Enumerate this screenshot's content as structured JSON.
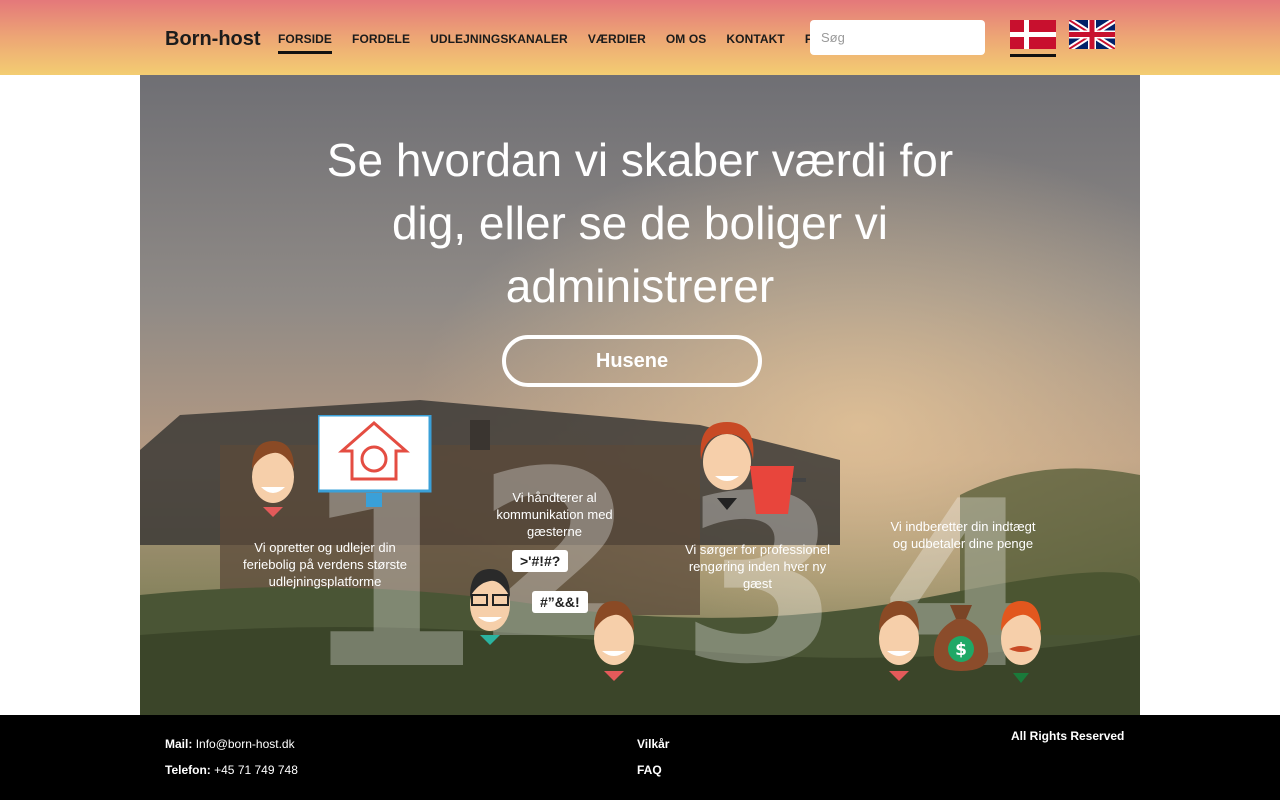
{
  "header": {
    "logo": "Born-host",
    "nav": [
      {
        "label": "FORSIDE"
      },
      {
        "label": "FORDELE"
      },
      {
        "label": "UDLEJNINGSKANALER"
      },
      {
        "label": "VÆRDIER"
      },
      {
        "label": "OM OS"
      },
      {
        "label": "KONTAKT"
      },
      {
        "label": "FAQ"
      }
    ],
    "active_nav": "FORSIDE",
    "search_placeholder": "Søg",
    "languages": [
      "danish-flag-icon",
      "uk-flag-icon"
    ],
    "active_language": "danish-flag-icon"
  },
  "hero": {
    "title": "Se hvordan vi skaber værdi for dig, eller se de boliger vi administrerer",
    "button": "Husene",
    "steps": [
      {
        "number": "1",
        "text": "Vi opretter og udlejer din feriebolig på verdens største udlejningsplatforme"
      },
      {
        "number": "2",
        "text": "Vi håndterer al kommunikation med gæsterne",
        "bubble1": ">'#!#?",
        "bubble2": "#”&&!"
      },
      {
        "number": "3",
        "text": "Vi sørger for professionel rengøring inden hver ny gæst"
      },
      {
        "number": "4",
        "text": "Vi indberetter din indtægt og udbetaler dine penge"
      }
    ]
  },
  "footer": {
    "mail_label": "Mail:",
    "mail_value": "Info@born-host.dk",
    "phone_label": "Telefon:",
    "phone_value": "+45 71 749 748",
    "links": [
      "Vilkår",
      "FAQ"
    ],
    "rights": "All Rights Reserved"
  },
  "colors": {
    "header_top": "#e4787a",
    "header_bottom": "#f3cd72",
    "footer": "#000000",
    "danish_red": "#c8102e",
    "uk_blue": "#012169"
  }
}
